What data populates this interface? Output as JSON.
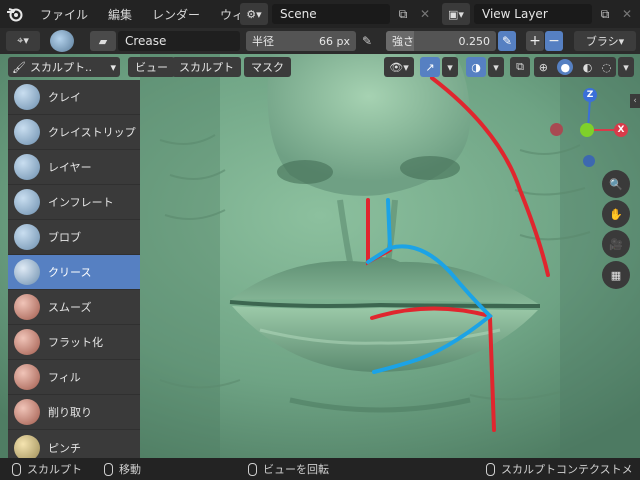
{
  "menubar": {
    "items": [
      "ファイル",
      "編集",
      "レンダー",
      "ウィンド"
    ],
    "scene": "Scene",
    "view_layer": "View Layer"
  },
  "tool_settings": {
    "brush_name": "Crease",
    "radius_label": "半径",
    "radius_value": "66 px",
    "strength_label": "強さ",
    "strength_value": "0.250",
    "strength_fraction": 0.25,
    "plus": "+",
    "minus": "−",
    "brush_menu": "ブラシ"
  },
  "header": {
    "mode": "スカルプト..",
    "menus": [
      "ビュー",
      "スカルプト",
      "マスク"
    ]
  },
  "tools": [
    {
      "label": "クレイ",
      "icon": "clay-icon",
      "color": "#8fb8dc"
    },
    {
      "label": "クレイストリップ",
      "icon": "clay-strips-icon",
      "color": "#8fb8dc"
    },
    {
      "label": "レイヤー",
      "icon": "layer-icon",
      "color": "#8fb8dc"
    },
    {
      "label": "インフレート",
      "icon": "inflate-icon",
      "color": "#8fb8dc"
    },
    {
      "label": "ブロブ",
      "icon": "blob-icon",
      "color": "#8fb8dc"
    },
    {
      "label": "クリース",
      "icon": "crease-icon",
      "color": "#8fb8dc",
      "active": true
    },
    {
      "label": "スムーズ",
      "icon": "smooth-icon",
      "color": "#d07a6a"
    },
    {
      "label": "フラット化",
      "icon": "flatten-icon",
      "color": "#d07a6a"
    },
    {
      "label": "フィル",
      "icon": "fill-icon",
      "color": "#d07a6a"
    },
    {
      "label": "削り取り",
      "icon": "scrape-icon",
      "color": "#d07a6a"
    },
    {
      "label": "ピンチ",
      "icon": "pinch-icon",
      "color": "#e8c86a"
    }
  ],
  "gizmo": {
    "z_label": "Z",
    "x_label": "X"
  },
  "statusbar": {
    "item1": "スカルプト",
    "item2": "移動",
    "item3": "ビューを回転",
    "item4": "スカルプトコンテクストメ"
  },
  "colors": {
    "accent": "#5680c2",
    "sculpt": "#7aa98a",
    "red_stroke": "#e0262e",
    "blue_stroke": "#1ca3e6"
  }
}
